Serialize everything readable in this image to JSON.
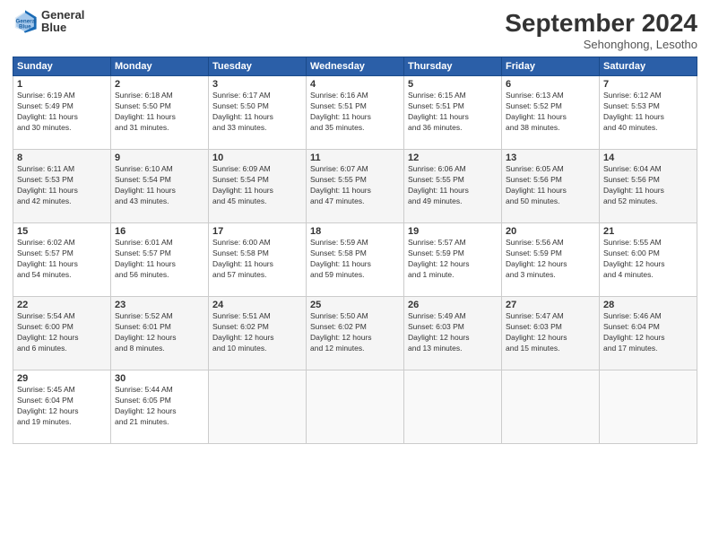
{
  "header": {
    "logo_line1": "General",
    "logo_line2": "Blue",
    "month": "September 2024",
    "location": "Sehonghong, Lesotho"
  },
  "weekdays": [
    "Sunday",
    "Monday",
    "Tuesday",
    "Wednesday",
    "Thursday",
    "Friday",
    "Saturday"
  ],
  "weeks": [
    [
      {
        "day": "1",
        "info": "Sunrise: 6:19 AM\nSunset: 5:49 PM\nDaylight: 11 hours\nand 30 minutes."
      },
      {
        "day": "2",
        "info": "Sunrise: 6:18 AM\nSunset: 5:50 PM\nDaylight: 11 hours\nand 31 minutes."
      },
      {
        "day": "3",
        "info": "Sunrise: 6:17 AM\nSunset: 5:50 PM\nDaylight: 11 hours\nand 33 minutes."
      },
      {
        "day": "4",
        "info": "Sunrise: 6:16 AM\nSunset: 5:51 PM\nDaylight: 11 hours\nand 35 minutes."
      },
      {
        "day": "5",
        "info": "Sunrise: 6:15 AM\nSunset: 5:51 PM\nDaylight: 11 hours\nand 36 minutes."
      },
      {
        "day": "6",
        "info": "Sunrise: 6:13 AM\nSunset: 5:52 PM\nDaylight: 11 hours\nand 38 minutes."
      },
      {
        "day": "7",
        "info": "Sunrise: 6:12 AM\nSunset: 5:53 PM\nDaylight: 11 hours\nand 40 minutes."
      }
    ],
    [
      {
        "day": "8",
        "info": "Sunrise: 6:11 AM\nSunset: 5:53 PM\nDaylight: 11 hours\nand 42 minutes."
      },
      {
        "day": "9",
        "info": "Sunrise: 6:10 AM\nSunset: 5:54 PM\nDaylight: 11 hours\nand 43 minutes."
      },
      {
        "day": "10",
        "info": "Sunrise: 6:09 AM\nSunset: 5:54 PM\nDaylight: 11 hours\nand 45 minutes."
      },
      {
        "day": "11",
        "info": "Sunrise: 6:07 AM\nSunset: 5:55 PM\nDaylight: 11 hours\nand 47 minutes."
      },
      {
        "day": "12",
        "info": "Sunrise: 6:06 AM\nSunset: 5:55 PM\nDaylight: 11 hours\nand 49 minutes."
      },
      {
        "day": "13",
        "info": "Sunrise: 6:05 AM\nSunset: 5:56 PM\nDaylight: 11 hours\nand 50 minutes."
      },
      {
        "day": "14",
        "info": "Sunrise: 6:04 AM\nSunset: 5:56 PM\nDaylight: 11 hours\nand 52 minutes."
      }
    ],
    [
      {
        "day": "15",
        "info": "Sunrise: 6:02 AM\nSunset: 5:57 PM\nDaylight: 11 hours\nand 54 minutes."
      },
      {
        "day": "16",
        "info": "Sunrise: 6:01 AM\nSunset: 5:57 PM\nDaylight: 11 hours\nand 56 minutes."
      },
      {
        "day": "17",
        "info": "Sunrise: 6:00 AM\nSunset: 5:58 PM\nDaylight: 11 hours\nand 57 minutes."
      },
      {
        "day": "18",
        "info": "Sunrise: 5:59 AM\nSunset: 5:58 PM\nDaylight: 11 hours\nand 59 minutes."
      },
      {
        "day": "19",
        "info": "Sunrise: 5:57 AM\nSunset: 5:59 PM\nDaylight: 12 hours\nand 1 minute."
      },
      {
        "day": "20",
        "info": "Sunrise: 5:56 AM\nSunset: 5:59 PM\nDaylight: 12 hours\nand 3 minutes."
      },
      {
        "day": "21",
        "info": "Sunrise: 5:55 AM\nSunset: 6:00 PM\nDaylight: 12 hours\nand 4 minutes."
      }
    ],
    [
      {
        "day": "22",
        "info": "Sunrise: 5:54 AM\nSunset: 6:00 PM\nDaylight: 12 hours\nand 6 minutes."
      },
      {
        "day": "23",
        "info": "Sunrise: 5:52 AM\nSunset: 6:01 PM\nDaylight: 12 hours\nand 8 minutes."
      },
      {
        "day": "24",
        "info": "Sunrise: 5:51 AM\nSunset: 6:02 PM\nDaylight: 12 hours\nand 10 minutes."
      },
      {
        "day": "25",
        "info": "Sunrise: 5:50 AM\nSunset: 6:02 PM\nDaylight: 12 hours\nand 12 minutes."
      },
      {
        "day": "26",
        "info": "Sunrise: 5:49 AM\nSunset: 6:03 PM\nDaylight: 12 hours\nand 13 minutes."
      },
      {
        "day": "27",
        "info": "Sunrise: 5:47 AM\nSunset: 6:03 PM\nDaylight: 12 hours\nand 15 minutes."
      },
      {
        "day": "28",
        "info": "Sunrise: 5:46 AM\nSunset: 6:04 PM\nDaylight: 12 hours\nand 17 minutes."
      }
    ],
    [
      {
        "day": "29",
        "info": "Sunrise: 5:45 AM\nSunset: 6:04 PM\nDaylight: 12 hours\nand 19 minutes."
      },
      {
        "day": "30",
        "info": "Sunrise: 5:44 AM\nSunset: 6:05 PM\nDaylight: 12 hours\nand 21 minutes."
      },
      {
        "day": "",
        "info": ""
      },
      {
        "day": "",
        "info": ""
      },
      {
        "day": "",
        "info": ""
      },
      {
        "day": "",
        "info": ""
      },
      {
        "day": "",
        "info": ""
      }
    ]
  ]
}
